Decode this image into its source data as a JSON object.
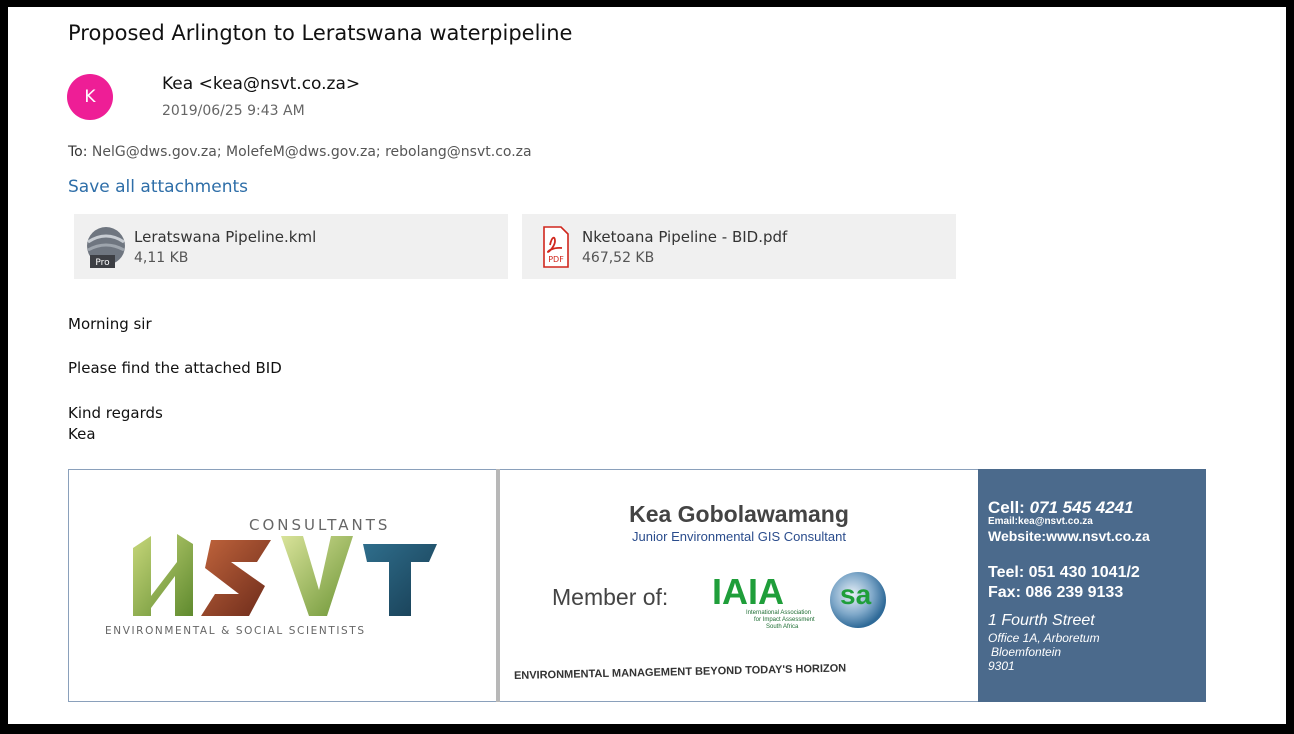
{
  "email": {
    "subject": "Proposed Arlington to Leratswana waterpipeline",
    "avatar_letter": "K",
    "avatar_color": "#ee1e96",
    "sender": "Kea <kea@nsvt.co.za>",
    "date": "2019/06/25 9:43 AM",
    "to_label": "To:",
    "to_recipients": "NelG@dws.gov.za; MolefeM@dws.gov.za; rebolang@nsvt.co.za",
    "save_all_label": "Save all attachments",
    "link_color": "#2e6ea8",
    "attachments": [
      {
        "name": "Leratswana Pipeline.kml",
        "size": "4,11 KB",
        "icon": "google-earth-pro-icon",
        "badge": "Pro"
      },
      {
        "name": "Nketoana Pipeline - BID.pdf",
        "size": "467,52 KB",
        "icon": "pdf-icon",
        "badge": "PDF"
      }
    ],
    "body_lines": [
      "Morning sir",
      "Please find the attached BID",
      "Kind regards",
      "Kea"
    ]
  },
  "signature": {
    "logo_consultants": "CONSULTANTS",
    "logo_letters": "NSVT",
    "logo_tagline": "ENVIRONMENTAL & SOCIAL SCIENTISTS",
    "name": "Kea Gobolawamang",
    "title": "Junior Environmental GIS Consultant",
    "member_of": "Member of:",
    "iaia_text": "IAIA",
    "iaia_suffix": "sa",
    "iaia_sub1": "International Association",
    "iaia_sub2": "for Impact Assessment",
    "iaia_sub3": "South Africa",
    "footer_tagline": "ENVIRONMENTAL MANAGEMENT BEYOND TODAY'S HORIZON",
    "cell_label": "Cell:",
    "cell_number": "071 545 4241",
    "email": "Email:kea@nsvt.co.za",
    "website": "Website:www.nsvt.co.za",
    "tel": "Teel: 051 430 1041/2",
    "fax": "Fax: 086 239 9133",
    "street": "1 Fourth Street",
    "address_lines": [
      "Office 1A, Arboretum",
      "Bloemfontein",
      "9301"
    ],
    "panel_color": "#4b6a8c"
  }
}
